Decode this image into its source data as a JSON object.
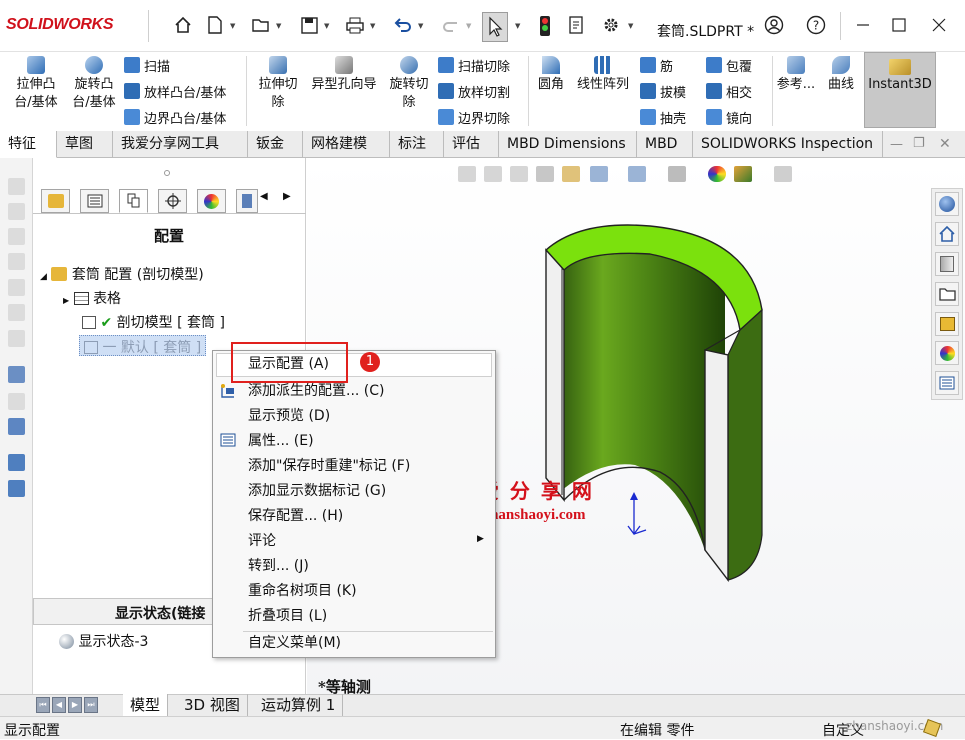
{
  "app": {
    "logo": "SOLIDWORKS",
    "doc_title": "套筒.SLDPRT *"
  },
  "ribbon": {
    "big": [
      {
        "label": "拉伸凸\n台/基体"
      },
      {
        "label": "旋转凸\n台/基体"
      }
    ],
    "col1": [
      "扫描",
      "放样凸台/基体",
      "边界凸台/基体"
    ],
    "big2": [
      {
        "label": "拉伸切\n除"
      },
      {
        "label": "异型孔向导"
      },
      {
        "label": "旋转切\n除"
      }
    ],
    "col2": [
      "扫描切除",
      "放样切割",
      "边界切除"
    ],
    "col3": [
      "圆角",
      "线性阵列"
    ],
    "col4": [
      "筋",
      "拔模",
      "抽壳"
    ],
    "col5": [
      "包覆",
      "相交",
      "镜向"
    ],
    "col6": [
      "参考...",
      "曲线"
    ],
    "instant3d": "Instant3D"
  },
  "tabs": [
    "特征",
    "草图",
    "我爱分享网工具",
    "钣金",
    "网格建模",
    "标注",
    "评估",
    "MBD Dimensions",
    "MBD",
    "SOLIDWORKS Inspection"
  ],
  "panel": {
    "header": "配置",
    "tree": {
      "root": "套筒 配置 (剖切模型)",
      "table": "表格",
      "config1": "剖切模型 [ 套筒 ]",
      "config2": "一 默认 [ 套筒 ]"
    },
    "display_state_header": "显示状态(链接",
    "display_state_item": "显示状态-3"
  },
  "context_menu": {
    "items": [
      "显示配置 (A)",
      "添加派生的配置... (C)",
      "显示预览 (D)",
      "属性... (E)",
      "添加\"保存时重建\"标记 (F)",
      "添加显示数据标记 (G)",
      "保存配置... (H)",
      "评论",
      "转到... (J)",
      "重命名树项目 (K)",
      "折叠项目 (L)",
      "自定义菜单(M)"
    ],
    "badge": "1"
  },
  "canvas": {
    "view_label": "*等轴测",
    "watermark_cn": "我 爱 分 享 网",
    "watermark_url": "www.zhanshaoyi.com",
    "colors": {
      "shell_dark": "#2f5f0c",
      "shell_light": "#6aa81e",
      "rim": "#7be10d"
    }
  },
  "bottom_tabs": [
    "模型",
    "3D 视图",
    "运动算例 1"
  ],
  "status": {
    "left": "显示配置",
    "middle": "在编辑 零件",
    "right": "自定义",
    "watermark": "zhanshaoyi.com"
  }
}
